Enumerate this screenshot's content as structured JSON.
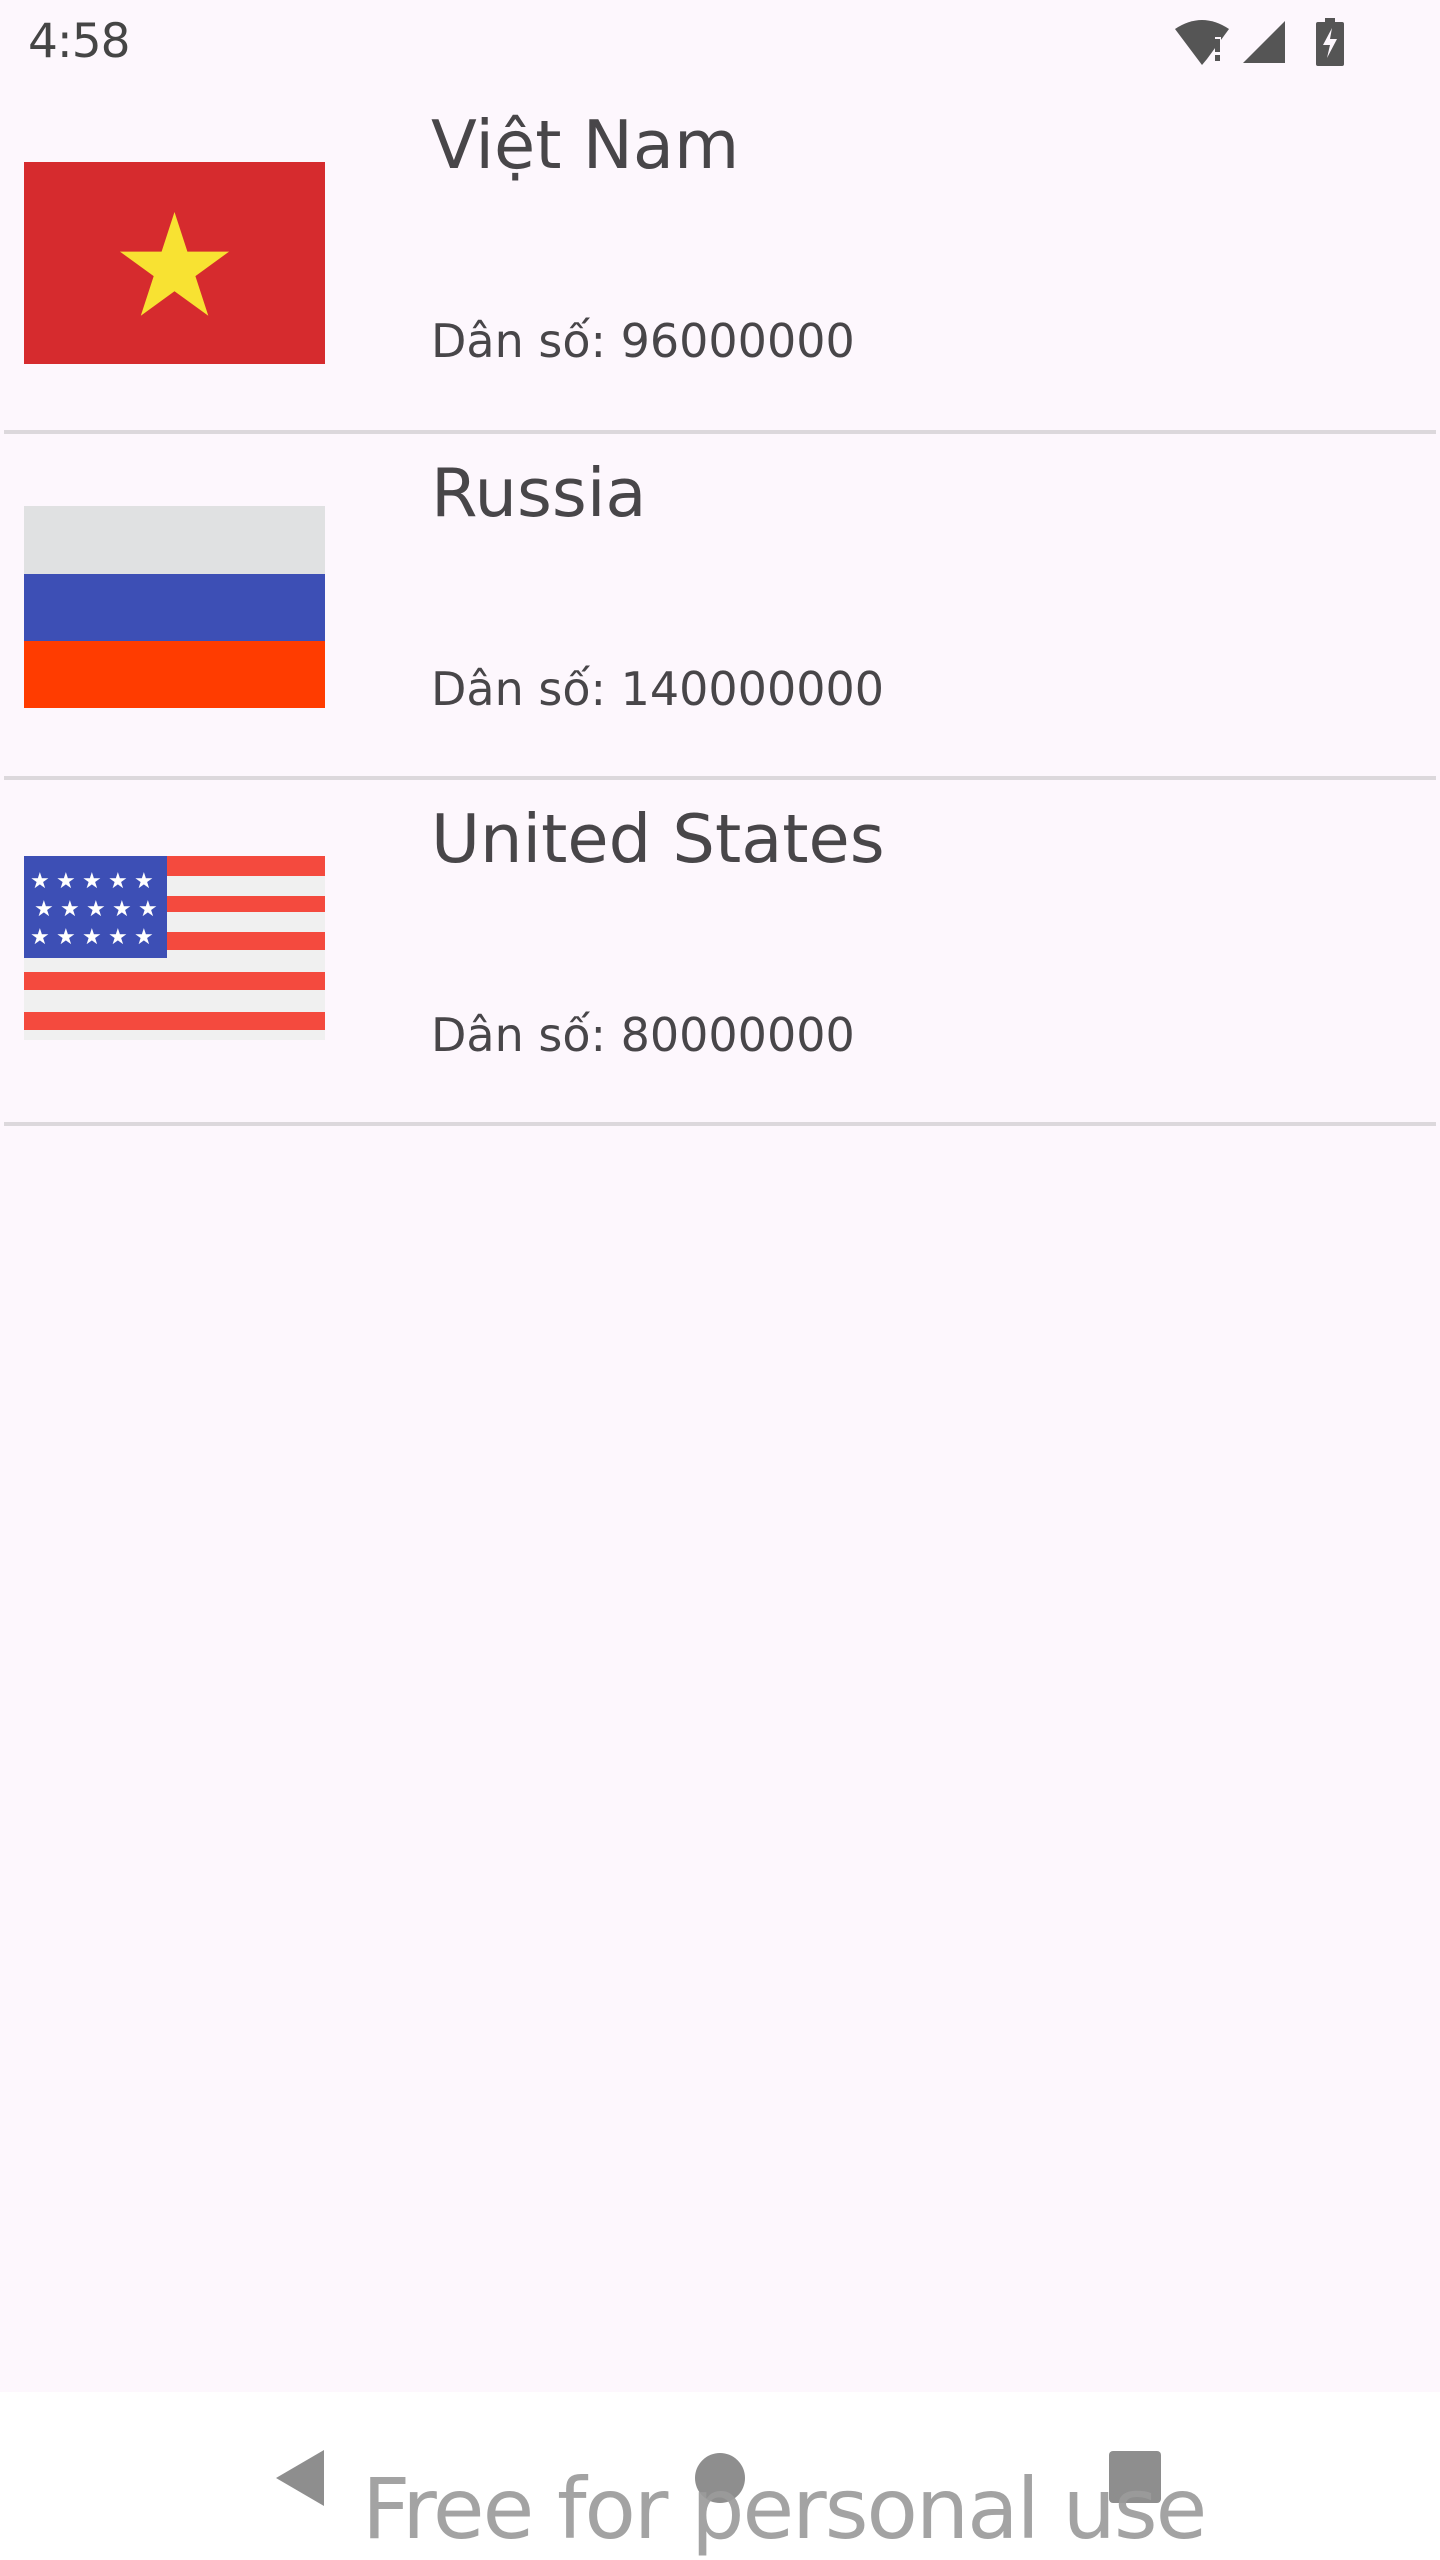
{
  "status_bar": {
    "time": "4:58",
    "icons": [
      "wifi-alert-icon",
      "cell-signal-icon",
      "battery-charging-icon"
    ]
  },
  "countries": [
    {
      "name": "Việt Nam",
      "population_label": "Dân số: 96000000",
      "flag": "vietnam-flag"
    },
    {
      "name": "Russia",
      "population_label": "Dân số: 140000000",
      "flag": "russia-flag"
    },
    {
      "name": "United States",
      "population_label": "Dân số: 80000000",
      "flag": "usa-flag"
    }
  ],
  "nav_bar": {
    "buttons": [
      "back-icon",
      "home-icon",
      "recents-icon"
    ]
  },
  "watermark": "Free for personal use",
  "colors": {
    "background": "#fdf7fd",
    "text": "#484649",
    "divider": "#dcd8dc"
  }
}
